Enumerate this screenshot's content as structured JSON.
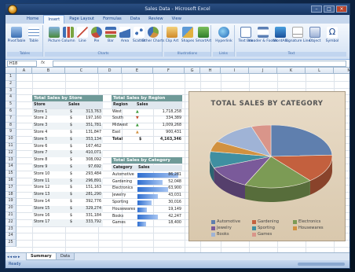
{
  "window": {
    "title": "Sales Data - Microsoft Excel"
  },
  "ribbon_tabs": [
    "Home",
    "Insert",
    "Page Layout",
    "Formulas",
    "Data",
    "Review",
    "View"
  ],
  "ribbon": {
    "groups": [
      {
        "name": "Tables",
        "buttons": [
          "PivotTable",
          "Table"
        ]
      },
      {
        "name": "Illustrations",
        "buttons": [
          "Picture",
          "Clip Art",
          "Shapes",
          "SmartArt"
        ]
      },
      {
        "name": "Charts",
        "buttons": [
          "Column",
          "Line",
          "Pie",
          "Bar",
          "Area",
          "Scatter",
          "Other Charts"
        ]
      },
      {
        "name": "Links",
        "buttons": [
          "Hyperlink"
        ]
      },
      {
        "name": "Text",
        "buttons": [
          "Text Box",
          "Header & Footer",
          "WordArt",
          "Signature Line",
          "Object",
          "Symbol"
        ]
      }
    ]
  },
  "formula_bar": {
    "name_box": "H18",
    "fx": ""
  },
  "columns": [
    "A",
    "B",
    "C",
    "D",
    "E",
    "F",
    "G",
    "H",
    "I",
    "J",
    "K",
    "L",
    "M"
  ],
  "rows": [
    "1",
    "2",
    "3",
    "4",
    "5",
    "6",
    "7",
    "8",
    "9",
    "10",
    "11",
    "12",
    "13",
    "14",
    "15",
    "16",
    "17",
    "18",
    "19",
    "20",
    "21",
    "22",
    "23",
    "24",
    "25"
  ],
  "store_table": {
    "title": "Total Sales by Store",
    "headers": [
      "Store",
      "Sales"
    ],
    "rows": [
      [
        "Store 1",
        "$",
        "313,763"
      ],
      [
        "Store 2",
        "$",
        "197,160"
      ],
      [
        "Store 3",
        "$",
        "351,781"
      ],
      [
        "Store 4",
        "$",
        "131,847"
      ],
      [
        "Store 5",
        "$",
        "353,134"
      ],
      [
        "Store 6",
        "$",
        "167,462"
      ],
      [
        "Store 7",
        "$",
        "410,071"
      ],
      [
        "Store 8",
        "$",
        "308,092"
      ],
      [
        "Store 9",
        "$",
        "97,692"
      ],
      [
        "Store 10",
        "$",
        "293,484"
      ],
      [
        "Store 11",
        "$",
        "296,891"
      ],
      [
        "Store 12",
        "$",
        "151,163"
      ],
      [
        "Store 13",
        "$",
        "281,290"
      ],
      [
        "Store 14",
        "$",
        "392,776"
      ],
      [
        "Store 15",
        "$",
        "329,274"
      ],
      [
        "Store 16",
        "$",
        "331,184"
      ],
      [
        "Store 17",
        "$",
        "333,792"
      ]
    ]
  },
  "region_table": {
    "title": "Total Sales by Region",
    "headers": [
      "Region",
      "Sales"
    ],
    "rows": [
      [
        "West",
        "1,718,258"
      ],
      [
        "South",
        "334,389"
      ],
      [
        "Midwest",
        "1,009,268"
      ],
      [
        "East",
        "900,431"
      ]
    ],
    "total_label": "Total",
    "total_value": "4,163,346"
  },
  "category_table": {
    "title": "Total Sales by Category",
    "headers": [
      "Category",
      "Sales"
    ],
    "rows": [
      {
        "name": "Automotive",
        "value": "86,281",
        "frac": 0.93
      },
      {
        "name": "Gardening",
        "value": "52,048",
        "frac": 0.57
      },
      {
        "name": "Electronics",
        "value": "63,900",
        "frac": 0.69
      },
      {
        "name": "Jewelry",
        "value": "43,031",
        "frac": 0.47
      },
      {
        "name": "Sporting",
        "value": "30,016",
        "frac": 0.33
      },
      {
        "name": "Housewares",
        "value": "19,149",
        "frac": 0.21
      },
      {
        "name": "Books",
        "value": "42,247",
        "frac": 0.46
      },
      {
        "name": "Games",
        "value": "18,400",
        "frac": 0.2
      }
    ]
  },
  "chart_data": {
    "type": "pie",
    "title": "TOTAL SALES BY CATEGORY",
    "categories": [
      "Automotive",
      "Gardening",
      "Electronics",
      "Jewelry",
      "Sporting",
      "Housewares",
      "Books",
      "Games"
    ],
    "values": [
      86281,
      52048,
      63900,
      43031,
      30016,
      19149,
      42247,
      18400
    ],
    "colors": [
      "#5f7fae",
      "#c3603e",
      "#7c9b55",
      "#7a5a9a",
      "#3f8fa1",
      "#d19140",
      "#9fb3d6",
      "#d9958a"
    ],
    "legend_position": "bottom"
  },
  "sheets": [
    "Summary",
    "Data"
  ],
  "status": {
    "text": "Ready"
  }
}
